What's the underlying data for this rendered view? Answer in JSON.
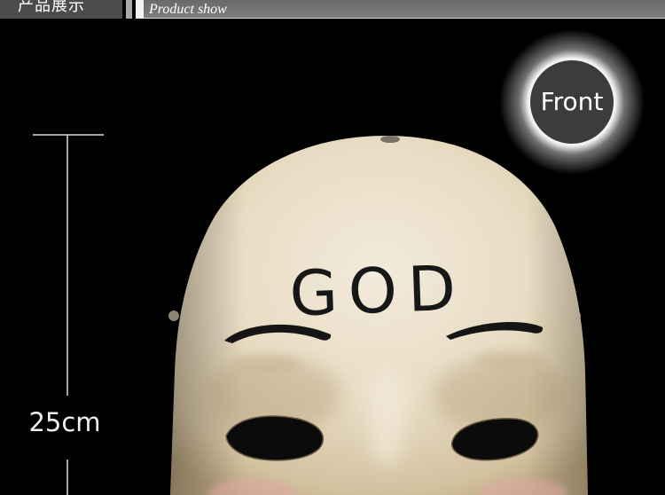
{
  "header": {
    "title_cn": "产品展示",
    "title_en": "Product show"
  },
  "dimension": {
    "label": "25cm"
  },
  "badge": {
    "label": "Front"
  },
  "product": {
    "forehead_text": "GOD"
  },
  "colors": {
    "background": "#000000",
    "header_dark": "#4c4c4c",
    "header_light": "#777777",
    "mask_skin": "#e9ddc6",
    "badge_fill": "#3c3c3c",
    "ink": "#151515"
  }
}
